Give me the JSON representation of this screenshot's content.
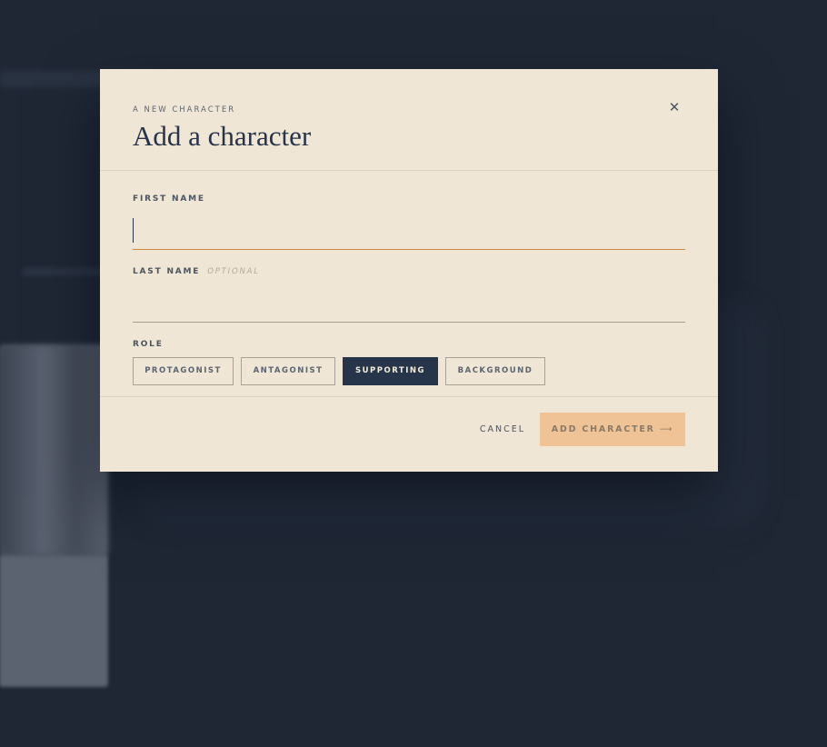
{
  "modal": {
    "eyebrow": "A NEW CHARACTER",
    "title": "Add a character",
    "close_icon": "close-icon",
    "fields": {
      "first_name": {
        "label": "FIRST NAME",
        "value": "",
        "placeholder": ""
      },
      "last_name": {
        "label": "LAST NAME",
        "optional_hint": "OPTIONAL",
        "value": "",
        "placeholder": ""
      },
      "role": {
        "label": "ROLE",
        "options": [
          "PROTAGONIST",
          "ANTAGONIST",
          "SUPPORTING",
          "BACKGROUND"
        ],
        "selected": "SUPPORTING"
      }
    },
    "footer": {
      "cancel_label": "CANCEL",
      "submit_label": "ADD CHARACTER",
      "submit_arrow": "⟶",
      "submit_icon": "arrow-right-icon"
    }
  },
  "colors": {
    "backdrop": "#1f2735",
    "modal_bg": "#efe6d6",
    "accent_underline": "#c98a3e",
    "selected_role_bg": "#26354a",
    "submit_bg": "#efc395",
    "title_text": "#26334a"
  }
}
